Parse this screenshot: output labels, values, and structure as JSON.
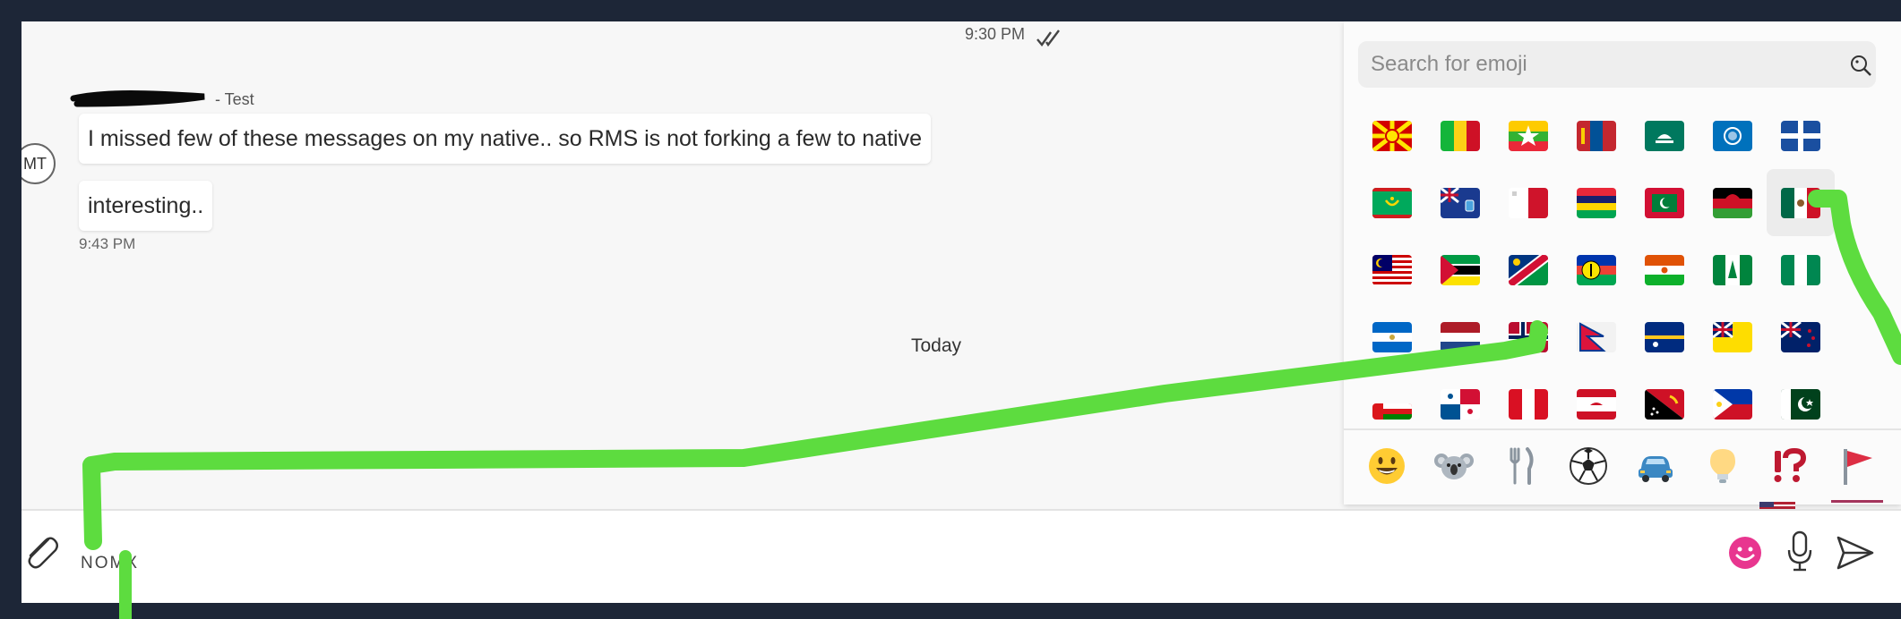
{
  "chat": {
    "top_timestamp": "9:30 PM",
    "sender_suffix": "- Test",
    "avatar_initials": "MT",
    "messages": [
      {
        "text": "I missed few of these messages on my native.. so RMS is not forking a few to native"
      },
      {
        "text": "interesting.."
      }
    ],
    "message_time": "9:43 PM",
    "day_divider": "Today"
  },
  "composer": {
    "text": "NOMX"
  },
  "emoji_picker": {
    "search_placeholder": "Search for emoji",
    "flags": [
      "North Macedonia",
      "Mali",
      "Myanmar",
      "Mongolia",
      "Macao",
      "Northern Mariana Islands",
      "Martinique",
      "Mauritania",
      "Montserrat",
      "Malta",
      "Mauritius",
      "Maldives",
      "Malawi",
      "Mexico",
      "Malaysia",
      "Mozambique",
      "Namibia",
      "New Caledonia",
      "Niger",
      "Norfolk Island",
      "Nigeria",
      "Nicaragua",
      "Netherlands",
      "Norway",
      "Nepal",
      "Nauru",
      "Niue",
      "New Zealand",
      "Oman",
      "Panama",
      "Peru",
      "French Polynesia",
      "Papua New Guinea",
      "Philippines",
      "Pakistan"
    ],
    "categories": [
      {
        "icon": "smiley-icon"
      },
      {
        "icon": "koala-icon"
      },
      {
        "icon": "fork-knife-icon"
      },
      {
        "icon": "soccer-ball-icon"
      },
      {
        "icon": "car-icon"
      },
      {
        "icon": "lightbulb-icon"
      },
      {
        "icon": "symbols-icon"
      },
      {
        "icon": "flag-icon"
      }
    ],
    "active_category": "flag-icon"
  },
  "colors": {
    "frame": "#1d2637",
    "chat_background": "#f7f7f7",
    "accent": "#e8368f",
    "annotation": "#5ddc3f"
  }
}
